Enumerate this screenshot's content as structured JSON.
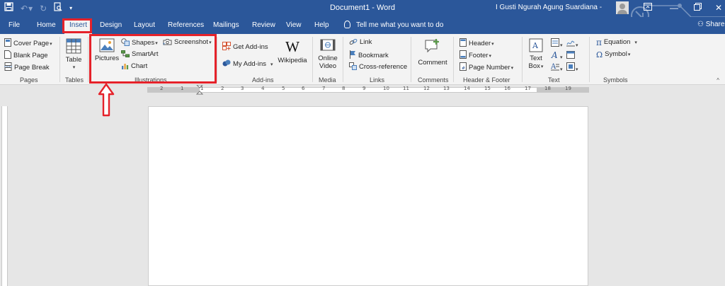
{
  "titlebar": {
    "document_title": "Document1  -  Word",
    "user_name": "I Gusti Ngurah Agung Suardiana -",
    "qat_icons": [
      "save-icon",
      "undo-icon",
      "redo-icon",
      "print-preview-icon",
      "customize-qat-icon"
    ],
    "window_controls": [
      "ribbon-display-options-icon",
      "minimize-icon",
      "restore-icon",
      "close-icon"
    ]
  },
  "tabs": [
    {
      "label": "File"
    },
    {
      "label": "Home"
    },
    {
      "label": "Insert",
      "active": true
    },
    {
      "label": "Design"
    },
    {
      "label": "Layout"
    },
    {
      "label": "References"
    },
    {
      "label": "Mailings"
    },
    {
      "label": "Review"
    },
    {
      "label": "View"
    },
    {
      "label": "Help"
    }
  ],
  "tell_me": "Tell me what you want to do",
  "share": "Share",
  "ribbon": {
    "pages": {
      "label": "Pages",
      "items": [
        "Cover Page",
        "Blank Page",
        "Page Break"
      ]
    },
    "tables": {
      "label": "Tables",
      "table": "Table"
    },
    "illustrations": {
      "label": "Illustrations",
      "pictures": "Pictures",
      "shapes": "Shapes",
      "screenshot": "Screenshot",
      "smartart": "SmartArt",
      "chart": "Chart"
    },
    "addins": {
      "label": "Add-ins",
      "get": "Get Add-ins",
      "my": "My Add-ins",
      "wikipedia": "Wikipedia",
      "wiki_letter": "W"
    },
    "media": {
      "label": "Media",
      "online_video_1": "Online",
      "online_video_2": "Video"
    },
    "links": {
      "label": "Links",
      "items": [
        "Link",
        "Bookmark",
        "Cross-reference"
      ]
    },
    "comments": {
      "label": "Comments",
      "comment": "Comment"
    },
    "header_footer": {
      "label": "Header & Footer",
      "items": [
        "Header",
        "Footer",
        "Page Number"
      ]
    },
    "text": {
      "label": "Text",
      "textbox_1": "Text",
      "textbox_2": "Box"
    },
    "symbols": {
      "label": "Symbols",
      "equation": "Equation",
      "symbol": "Symbol",
      "pi": "π",
      "omega": "Ω"
    }
  },
  "ruler": {
    "numbers": [
      "2",
      "1",
      "1",
      "2",
      "3",
      "4",
      "5",
      "6",
      "7",
      "8",
      "9",
      "10",
      "11",
      "12",
      "13",
      "14",
      "15",
      "16",
      "17",
      "18",
      "19"
    ]
  },
  "colors": {
    "brand": "#2b579a",
    "annotation": "#e5222a",
    "ribbon_bg": "#f3f3f3"
  }
}
